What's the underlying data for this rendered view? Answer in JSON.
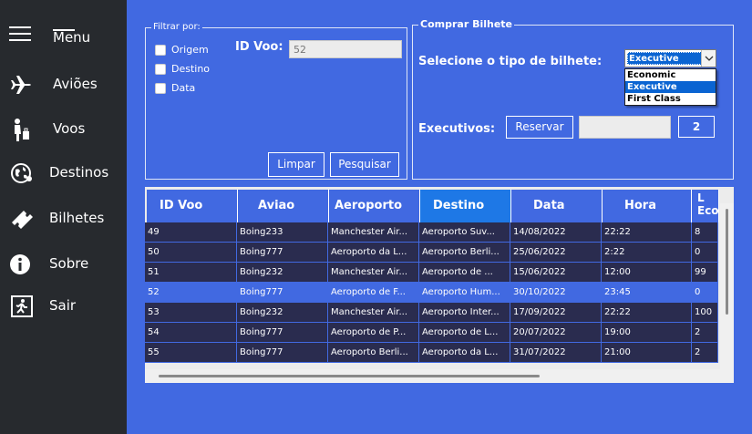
{
  "sidebar": {
    "menu_label": "Menu",
    "items": [
      {
        "label": "Aviões",
        "icon": "airplane-icon"
      },
      {
        "label": "Voos",
        "icon": "passenger-luggage-icon"
      },
      {
        "label": "Destinos",
        "icon": "globe-icon"
      },
      {
        "label": "Bilhetes",
        "icon": "ticket-icon"
      },
      {
        "label": "Sobre",
        "icon": "info-icon"
      },
      {
        "label": "Sair",
        "icon": "exit-icon"
      }
    ]
  },
  "filter": {
    "legend": "Filtrar por:",
    "checkboxes": [
      "Origem",
      "Destino",
      "Data"
    ],
    "id_label": "ID Voo:",
    "id_value": "52",
    "clear_label": "Limpar",
    "search_label": "Pesquisar"
  },
  "buy": {
    "legend": "Comprar Bilhete",
    "select_label": "Selecione o tipo de bilhete:",
    "selected": "Executive",
    "options": [
      "Economic",
      "Executive",
      "First Class"
    ],
    "count_label": "Executivos:",
    "reserve_label": "Reservar",
    "count_value": "2"
  },
  "table": {
    "headers": [
      "ID Voo",
      "Aviao",
      "Aeroporto",
      "Destino",
      "Data",
      "Hora",
      "L Eco"
    ],
    "rows": [
      [
        "49",
        "Boing233",
        "Manchester Air...",
        "Aeroporto Suv...",
        "14/08/2022",
        "22:22",
        "8"
      ],
      [
        "50",
        "Boing777",
        "Aeroporto da L...",
        "Aeroporto Berli...",
        "25/06/2022",
        " 2:22",
        "0"
      ],
      [
        "51",
        "Boing232",
        "Manchester Air...",
        "Aeroporto de ...",
        "15/06/2022",
        "12:00",
        "99"
      ],
      [
        "52",
        "Boing777",
        "Aeroporto de F...",
        "Aeroporto Hum...",
        "30/10/2022",
        "23:45",
        "0"
      ],
      [
        "53",
        "Boing232",
        "Manchester Air...",
        "Aeroporto Inter...",
        "17/09/2022",
        "22:22",
        "100"
      ],
      [
        "54",
        "Boing777",
        "Aeroporto de P...",
        "Aeroporto de L...",
        "20/07/2022",
        "19:00",
        "2"
      ],
      [
        "55",
        "Boing777",
        "Aeroporto Berli...",
        "Aeroporto da L...",
        "31/07/2022",
        "21:00",
        "2"
      ]
    ]
  },
  "colors": {
    "background": "#4169e1",
    "sidebar": "#272a2e",
    "row": "#2a2c4f",
    "selected_header": "#1e78e6"
  }
}
